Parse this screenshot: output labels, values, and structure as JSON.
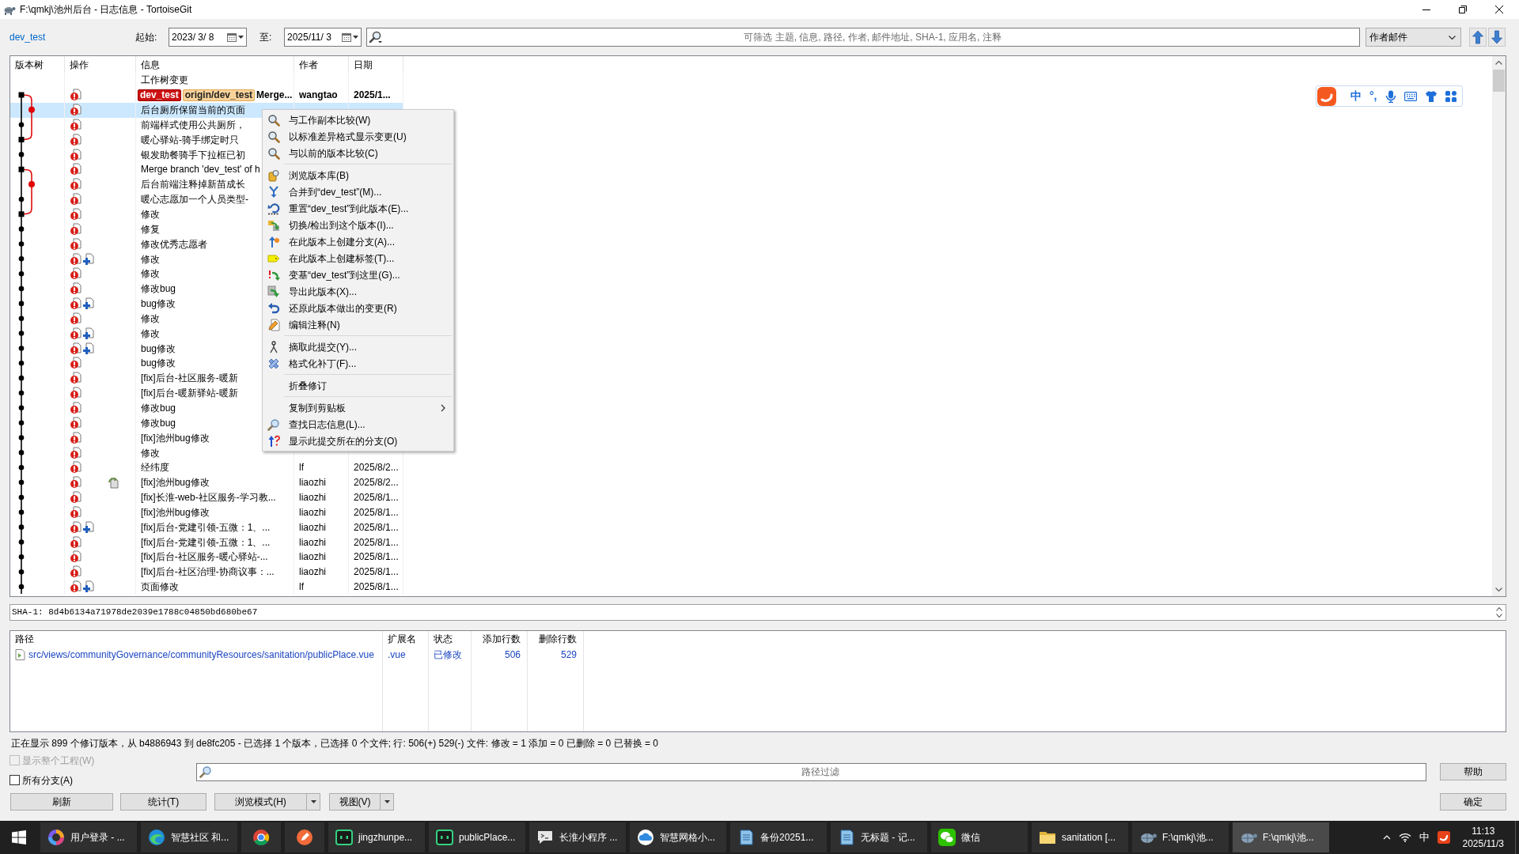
{
  "window": {
    "title": "F:\\qmkj\\池州后台 - 日志信息 - TortoiseGit"
  },
  "toolbar": {
    "branch": "dev_test",
    "from": {
      "label": "起始:",
      "value": "2023/ 3/ 8"
    },
    "to": {
      "label": "至:",
      "value": "2025/11/ 3"
    },
    "search": {
      "placeholder": "可筛选 主题, 信息, 路径, 作者, 邮件地址, SHA-1, 应用名, 注释"
    },
    "filter_by": "作者邮件"
  },
  "log": {
    "columns": [
      "版本树",
      "操作",
      "信息",
      "作者",
      "日期"
    ],
    "rows": [
      {
        "message": "工作树变更",
        "modified": false,
        "added": false,
        "renamed": false,
        "selected": false,
        "current": false
      },
      {
        "refs": [
          {
            "label": "dev_test",
            "kind": "local"
          },
          {
            "label": "origin/dev_test",
            "kind": "remote"
          }
        ],
        "message": "Merge...",
        "author": "wangtao",
        "date": "2025/1...",
        "modified": true,
        "added": false,
        "renamed": false,
        "selected": false,
        "current": true
      },
      {
        "message": "后台厕所保留当前的页面",
        "modified": true,
        "added": false,
        "renamed": false,
        "selected": true,
        "current": false
      },
      {
        "message": "前端样式使用公共厕所，",
        "modified": true,
        "added": false,
        "renamed": false,
        "selected": false,
        "current": false
      },
      {
        "message": "暖心驿站-骑手绑定时只",
        "modified": true,
        "added": false,
        "renamed": false,
        "selected": false,
        "current": false
      },
      {
        "message": "银发助餐骑手下拉框已初",
        "modified": true,
        "added": false,
        "renamed": false,
        "selected": false,
        "current": false
      },
      {
        "message": "Merge branch 'dev_test' of h",
        "modified": true,
        "added": false,
        "renamed": false,
        "selected": false,
        "current": false
      },
      {
        "message": "后台前端注释掉新苗成长",
        "modified": true,
        "added": false,
        "renamed": false,
        "selected": false,
        "current": false
      },
      {
        "message": "暖心志愿加一个人员类型-",
        "modified": true,
        "added": false,
        "renamed": false,
        "selected": false,
        "current": false
      },
      {
        "message": "修改",
        "modified": true,
        "added": false,
        "renamed": false,
        "selected": false,
        "current": false
      },
      {
        "message": "修复",
        "modified": true,
        "added": false,
        "renamed": false,
        "selected": false,
        "current": false
      },
      {
        "message": "修改优秀志愿者",
        "modified": true,
        "added": false,
        "renamed": false,
        "selected": false,
        "current": false
      },
      {
        "message": "修改",
        "modified": true,
        "added": true,
        "renamed": false,
        "selected": false,
        "current": false
      },
      {
        "message": "修改",
        "modified": true,
        "added": false,
        "renamed": false,
        "selected": false,
        "current": false
      },
      {
        "message": "修改bug",
        "modified": true,
        "added": false,
        "renamed": false,
        "selected": false,
        "current": false
      },
      {
        "message": "bug修改",
        "modified": true,
        "added": true,
        "renamed": false,
        "selected": false,
        "current": false
      },
      {
        "message": "修改",
        "modified": true,
        "added": false,
        "renamed": false,
        "selected": false,
        "current": false
      },
      {
        "message": "修改",
        "modified": true,
        "added": true,
        "renamed": false,
        "selected": false,
        "current": false
      },
      {
        "message": "bug修改",
        "modified": true,
        "added": true,
        "renamed": false,
        "selected": false,
        "current": false
      },
      {
        "message": "bug修改",
        "modified": true,
        "added": false,
        "renamed": false,
        "selected": false,
        "current": false
      },
      {
        "message": "[fix]后台-社区服务-暖新",
        "modified": true,
        "added": false,
        "renamed": false,
        "selected": false,
        "current": false
      },
      {
        "message": "[fix]后台-暖新驿站-暖新",
        "modified": true,
        "added": false,
        "renamed": false,
        "selected": false,
        "current": false
      },
      {
        "message": "修改bug",
        "modified": true,
        "added": false,
        "renamed": false,
        "selected": false,
        "current": false
      },
      {
        "message": "修改bug",
        "modified": true,
        "added": false,
        "renamed": false,
        "selected": false,
        "current": false
      },
      {
        "message": "[fix]池州bug修改",
        "modified": true,
        "added": false,
        "renamed": false,
        "selected": false,
        "current": false
      },
      {
        "message": "修改",
        "modified": true,
        "added": false,
        "renamed": false,
        "selected": false,
        "current": false
      },
      {
        "message": "经纬度",
        "author": "lf",
        "date": "2025/8/2...",
        "modified": true,
        "added": false,
        "renamed": false,
        "selected": false,
        "current": false
      },
      {
        "message": "[fix]池州bug修改",
        "author": "liaozhi",
        "date": "2025/8/2...",
        "modified": true,
        "added": false,
        "renamed": true,
        "selected": false,
        "current": false
      },
      {
        "message": "[fix]长淮-web-社区服务-学习教...",
        "author": "liaozhi",
        "date": "2025/8/1...",
        "modified": true,
        "added": false,
        "renamed": false,
        "selected": false,
        "current": false
      },
      {
        "message": "[fix]池州bug修改",
        "author": "liaozhi",
        "date": "2025/8/1...",
        "modified": true,
        "added": false,
        "renamed": false,
        "selected": false,
        "current": false
      },
      {
        "message": "[fix]后台-党建引领-五微：1、...",
        "author": "liaozhi",
        "date": "2025/8/1...",
        "modified": true,
        "added": true,
        "renamed": false,
        "selected": false,
        "current": false
      },
      {
        "message": "[fix]后台-党建引领-五微：1、...",
        "author": "liaozhi",
        "date": "2025/8/1...",
        "modified": true,
        "added": false,
        "renamed": false,
        "selected": false,
        "current": false
      },
      {
        "message": "[fix]后台-社区服务-暖心驿站-...",
        "author": "liaozhi",
        "date": "2025/8/1...",
        "modified": true,
        "added": false,
        "renamed": false,
        "selected": false,
        "current": false
      },
      {
        "message": "[fix]后台-社区治理-协商议事：...",
        "author": "liaozhi",
        "date": "2025/8/1...",
        "modified": true,
        "added": false,
        "renamed": false,
        "selected": false,
        "current": false
      },
      {
        "message": "页面修改",
        "author": "lf",
        "date": "2025/8/1...",
        "modified": true,
        "added": true,
        "renamed": false,
        "selected": false,
        "current": false
      }
    ]
  },
  "context_menu": {
    "items": [
      {
        "kind": "item",
        "label": "与工作副本比较(W)",
        "submenu": false
      },
      {
        "kind": "item",
        "label": "以标准差异格式显示变更(U)",
        "submenu": false
      },
      {
        "kind": "item",
        "label": "与以前的版本比较(C)",
        "submenu": false
      },
      {
        "kind": "separator"
      },
      {
        "kind": "item",
        "label": "浏览版本库(B)",
        "submenu": false
      },
      {
        "kind": "item",
        "label": "合并到“dev_test”(M)...",
        "submenu": false
      },
      {
        "kind": "item",
        "label": "重置“dev_test”到此版本(E)...",
        "submenu": false
      },
      {
        "kind": "item",
        "label": "切换/检出到这个版本(I)...",
        "submenu": false
      },
      {
        "kind": "item",
        "label": "在此版本上创建分支(A)...",
        "submenu": false
      },
      {
        "kind": "item",
        "label": "在此版本上创建标签(T)...",
        "submenu": false
      },
      {
        "kind": "item",
        "label": "变基“dev_test”到这里(G)...",
        "submenu": false
      },
      {
        "kind": "item",
        "label": "导出此版本(X)...",
        "submenu": false
      },
      {
        "kind": "item",
        "label": "还原此版本做出的变更(R)",
        "submenu": false
      },
      {
        "kind": "item",
        "label": "编辑注释(N)",
        "submenu": false
      },
      {
        "kind": "separator"
      },
      {
        "kind": "item",
        "label": "摘取此提交(Y)...",
        "submenu": false
      },
      {
        "kind": "item",
        "label": "格式化补丁(F)...",
        "submenu": false
      },
      {
        "kind": "separator"
      },
      {
        "kind": "item",
        "label": "折叠修订",
        "submenu": false
      },
      {
        "kind": "separator"
      },
      {
        "kind": "item",
        "label": "复制到剪贴板",
        "submenu": true
      },
      {
        "kind": "item",
        "label": "查找日志信息(L)...",
        "submenu": false
      },
      {
        "kind": "item",
        "label": "显示此提交所在的分支(O)",
        "submenu": false
      }
    ]
  },
  "ime_toolbar": {
    "language": "中",
    "punctuation": "°,"
  },
  "sha": "SHA-1: 8d4b6134a71978de2039e1788c04850bd680be67",
  "files": {
    "columns": [
      "路径",
      "扩展名",
      "状态",
      "添加行数",
      "删除行数"
    ],
    "rows": [
      {
        "path": "src/views/communityGovernance/communityResources/sanitation/publicPlace.vue",
        "extension": ".vue",
        "status": "已修改",
        "added": "506",
        "deleted": "529"
      }
    ]
  },
  "status_line": "正在显示 899 个修订版本，从 b4886943 到 de8fc205 - 已选择 1 个版本，已选择 0 个文件; 行: 506(+) 529(-) 文件: 修改 = 1 添加 = 0 已删除 = 0 已替换 = 0",
  "options": [
    {
      "label": "显示整个工程(W)",
      "checked": false,
      "disabled": true
    },
    {
      "label": "所有分支(A)",
      "checked": false,
      "disabled": false
    }
  ],
  "path_filter": {
    "placeholder": "路径过滤"
  },
  "buttons": [
    {
      "label": "刷新",
      "kind": "plain"
    },
    {
      "label": "统计(T)",
      "kind": "plain"
    },
    {
      "label": "浏览模式(H)",
      "kind": "split"
    },
    {
      "label": "视图(V)",
      "kind": "split"
    }
  ],
  "help_button": "帮助",
  "ok_button": "确定",
  "taskbar": {
    "apps": [
      {
        "label": "用户登录 - ...",
        "active": false
      },
      {
        "label": "智慧社区 和...",
        "active": false
      },
      {
        "active": false
      },
      {
        "active": false
      },
      {
        "label": "jingzhunpe...",
        "active": false
      },
      {
        "label": "publicPlace...",
        "active": false
      },
      {
        "label": "长淮小程序 ...",
        "active": false
      },
      {
        "label": "智慧网格小...",
        "active": false
      },
      {
        "label": "备份20251...",
        "active": false
      },
      {
        "label": "无标题 - 记...",
        "active": false
      },
      {
        "label": "微信",
        "active": false
      },
      {
        "label": "sanitation [...",
        "active": false
      },
      {
        "label": "F:\\qmkj\\池...",
        "active": false
      },
      {
        "label": "F:\\qmkj\\池...",
        "active": true
      }
    ],
    "tray": {
      "ime": "中",
      "time": "11:13",
      "date": "2025/11/3"
    }
  }
}
